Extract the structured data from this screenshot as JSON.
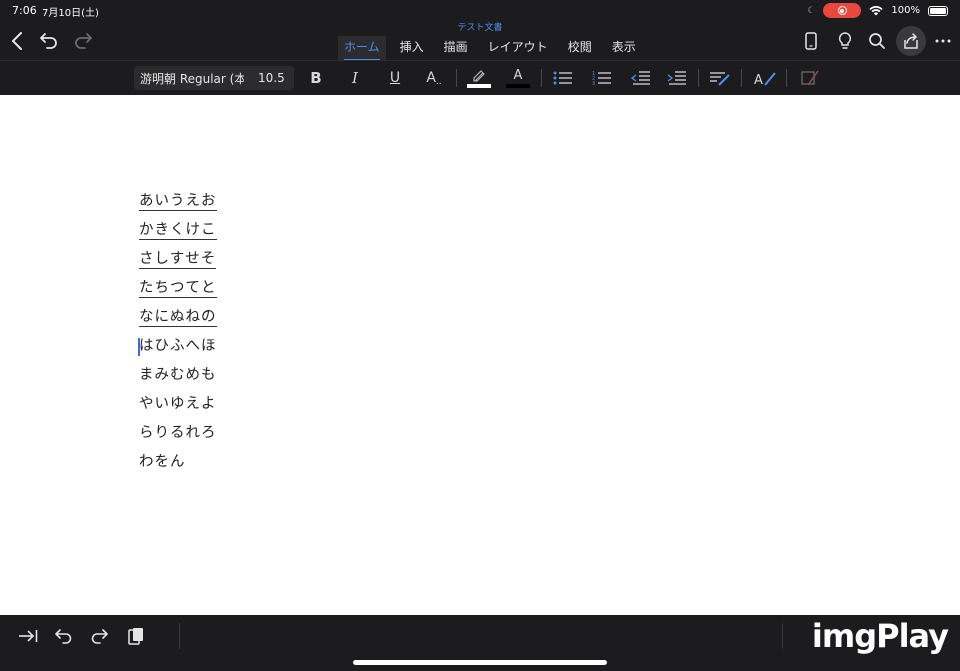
{
  "status": {
    "time": "7:06",
    "date": "7月10日(土)",
    "battery": "100%"
  },
  "document": {
    "title": "テスト文書"
  },
  "tabs": [
    {
      "label": "ホーム",
      "active": true
    },
    {
      "label": "挿入",
      "active": false
    },
    {
      "label": "描画",
      "active": false
    },
    {
      "label": "レイアウト",
      "active": false
    },
    {
      "label": "校閲",
      "active": false
    },
    {
      "label": "表示",
      "active": false
    }
  ],
  "ribbon": {
    "font_name": "游明朝 Regular (本",
    "font_size": "10.5",
    "bold": "B",
    "italic": "I",
    "underline": "U",
    "text_effects": "A",
    "font_color_letter": "A"
  },
  "content": {
    "lines": [
      {
        "text": "あいうえお",
        "underlined": true
      },
      {
        "text": "かきくけこ",
        "underlined": true
      },
      {
        "text": "さしすせそ",
        "underlined": true
      },
      {
        "text": "たちつてと",
        "underlined": true
      },
      {
        "text": "なにぬねの",
        "underlined": true
      },
      {
        "text": "はひふへほ",
        "underlined": false,
        "caret": true
      },
      {
        "text": "まみむめも",
        "underlined": false
      },
      {
        "text": "やいゆえよ",
        "underlined": false
      },
      {
        "text": "らりるれろ",
        "underlined": false
      },
      {
        "text": "わをん",
        "underlined": false
      }
    ]
  },
  "watermark": "imgPlay",
  "colors": {
    "accent": "#4a8ff0",
    "chrome": "#1c1c1e",
    "record": "#e8483d",
    "caret": "#3b6ae0"
  }
}
